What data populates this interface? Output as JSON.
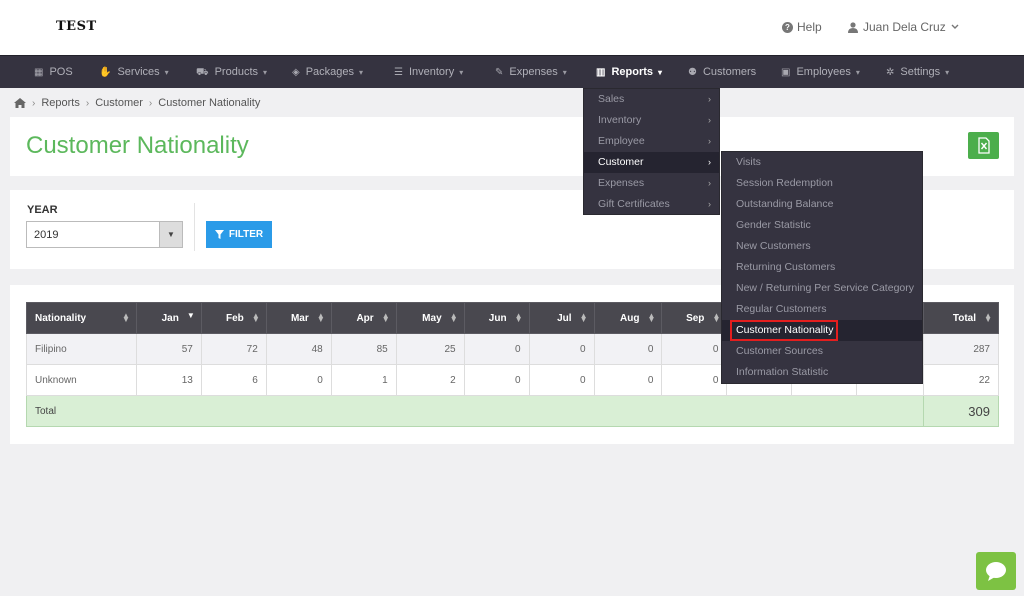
{
  "header": {
    "logo": "TEST",
    "help_label": "Help",
    "user_name": "Juan Dela Cruz"
  },
  "nav": {
    "items": [
      {
        "label": "POS",
        "icon": "calculator-icon"
      },
      {
        "label": "Services",
        "icon": "hand-icon"
      },
      {
        "label": "Products",
        "icon": "cart-icon"
      },
      {
        "label": "Packages",
        "icon": "tags-icon"
      },
      {
        "label": "Inventory",
        "icon": "list-icon"
      },
      {
        "label": "Expenses",
        "icon": "edit-icon"
      },
      {
        "label": "Reports",
        "icon": "bar-chart-icon",
        "active": true
      },
      {
        "label": "Customers",
        "icon": "users-icon"
      },
      {
        "label": "Employees",
        "icon": "briefcase-icon"
      },
      {
        "label": "Settings",
        "icon": "gear-icon"
      }
    ]
  },
  "breadcrumb": [
    "Reports",
    "Customer",
    "Customer Nationality"
  ],
  "page": {
    "title": "Customer Nationality",
    "year_label": "YEAR",
    "year_value": "2019",
    "filter_label": "FILTER"
  },
  "table": {
    "headers": [
      "Nationality",
      "Jan",
      "Feb",
      "Mar",
      "Apr",
      "May",
      "Jun",
      "Jul",
      "Aug",
      "Sep",
      "",
      "",
      "",
      "Total"
    ],
    "rows": [
      {
        "nationality": "Filipino",
        "values": [
          "57",
          "72",
          "48",
          "85",
          "25",
          "0",
          "0",
          "0",
          "0"
        ],
        "total": "287"
      },
      {
        "nationality": "Unknown",
        "values": [
          "13",
          "6",
          "0",
          "1",
          "2",
          "0",
          "0",
          "0",
          "0"
        ],
        "total": "22"
      }
    ],
    "total_label": "Total",
    "grand_total": "309"
  },
  "reports_menu": [
    {
      "label": "Sales"
    },
    {
      "label": "Inventory"
    },
    {
      "label": "Employee"
    },
    {
      "label": "Customer",
      "active": true
    },
    {
      "label": "Expenses"
    },
    {
      "label": "Gift Certificates"
    }
  ],
  "customer_submenu": [
    {
      "label": "Visits"
    },
    {
      "label": "Session Redemption"
    },
    {
      "label": "Outstanding Balance"
    },
    {
      "label": "Gender Statistic"
    },
    {
      "label": "New Customers"
    },
    {
      "label": "Returning Customers"
    },
    {
      "label": "New / Returning Per Service Category"
    },
    {
      "label": "Regular Customers"
    },
    {
      "label": "Customer Nationality",
      "selected": true
    },
    {
      "label": "Customer Sources"
    },
    {
      "label": "Information Statistic"
    }
  ],
  "colors": {
    "accent_green": "#5cb85c",
    "nav_bg": "#353340",
    "filter_blue": "#2b9be8",
    "highlight_red": "#e41e1e"
  }
}
